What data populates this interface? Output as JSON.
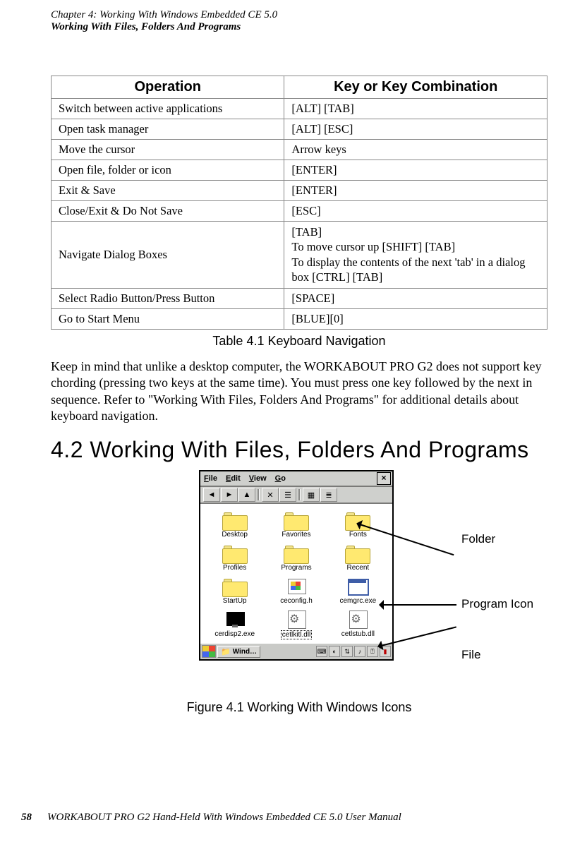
{
  "header": {
    "chapter_line": "Chapter 4: Working With Windows Embedded CE 5.0",
    "section_line": "Working With Files, Folders And Programs"
  },
  "table": {
    "headers": {
      "op": "Operation",
      "key": "Key or Key Combination"
    },
    "rows": [
      {
        "op": "Switch between active applications",
        "key": "[ALT] [TAB]"
      },
      {
        "op": "Open task manager",
        "key": "[ALT] [ESC]"
      },
      {
        "op": "Move the cursor",
        "key": "Arrow keys"
      },
      {
        "op": "Open file, folder or icon",
        "key": "[ENTER]"
      },
      {
        "op": "Exit & Save",
        "key": "[ENTER]"
      },
      {
        "op": "Close/Exit & Do Not Save",
        "key": "[ESC]"
      },
      {
        "op": "Navigate Dialog Boxes",
        "key": "[TAB]\nTo move cursor up [SHIFT] [TAB]\nTo display the contents of the next 'tab' in a dialog box [CTRL] [TAB]"
      },
      {
        "op": "Select Radio Button/Press Button",
        "key": "[SPACE]"
      },
      {
        "op": "Go to Start Menu",
        "key": "[BLUE][0]"
      }
    ],
    "caption": "Table 4.1  Keyboard Navigation"
  },
  "paragraph": "Keep in mind that unlike a desktop computer, the WORKABOUT PRO G2 does not support key chording (pressing two keys at the same time). You must press one key followed by the next in sequence. Refer to \"Working With Files, Folders And Programs\" for additional details about keyboard navigation.",
  "section_heading": "4.2  Working With Files, Folders And Programs",
  "ce_window": {
    "menus": {
      "file": "File",
      "edit": "Edit",
      "view": "View",
      "go": "Go"
    },
    "close_symbol": "×",
    "toolbar_icons": [
      "back-icon",
      "forward-icon",
      "up-icon",
      "delete-icon",
      "properties-icon",
      "large-icons-icon",
      "details-icon"
    ],
    "items": [
      {
        "label": "Desktop",
        "type": "folder"
      },
      {
        "label": "Favorites",
        "type": "folder"
      },
      {
        "label": "Fonts",
        "type": "folder"
      },
      {
        "label": "Profiles",
        "type": "folder"
      },
      {
        "label": "Programs",
        "type": "folder"
      },
      {
        "label": "Recent",
        "type": "folder"
      },
      {
        "label": "StartUp",
        "type": "folder"
      },
      {
        "label": "ceconfig.h",
        "type": "flag"
      },
      {
        "label": "cemgrc.exe",
        "type": "exe"
      },
      {
        "label": "cerdisp2.exe",
        "type": "disp"
      },
      {
        "label": "cetlkitl.dll",
        "type": "gear",
        "selected": true
      },
      {
        "label": "cetlstub.dll",
        "type": "gear"
      }
    ],
    "taskbar": {
      "task_label": "Wind…"
    }
  },
  "annotations": {
    "folder": "Folder",
    "program_icon": "Program Icon",
    "file": "File"
  },
  "figure_caption": "Figure 4.1 Working With Windows Icons",
  "footer": {
    "page_number": "58",
    "manual_title": "WORKABOUT PRO G2 Hand-Held With Windows Embedded CE 5.0 User Manual"
  }
}
